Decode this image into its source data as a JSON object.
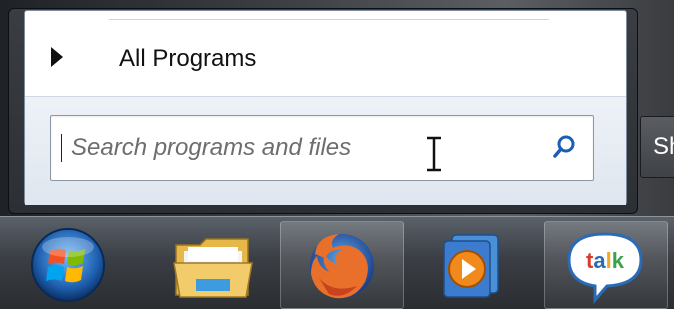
{
  "start_menu": {
    "all_programs_label": "All Programs",
    "search": {
      "placeholder": "Search programs and files",
      "value": ""
    },
    "shutdown_label": "Sh"
  },
  "taskbar": {
    "items": [
      {
        "name": "start-orb",
        "icon": "windows-start-orb"
      },
      {
        "name": "windows-explorer",
        "icon": "folder-icon"
      },
      {
        "name": "firefox",
        "icon": "firefox-icon"
      },
      {
        "name": "media-player",
        "icon": "media-player-icon"
      },
      {
        "name": "google-talk",
        "icon": "google-talk-icon",
        "label": "talk"
      }
    ]
  },
  "colors": {
    "accent_blue": "#1a5fb4",
    "taskbar_dark": "#2a2d31"
  }
}
